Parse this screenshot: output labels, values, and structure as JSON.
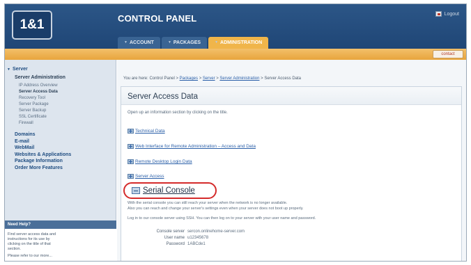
{
  "header": {
    "logo": "1&1",
    "title": "CONTROL PANEL",
    "logout_label": "Logout",
    "tabs": [
      {
        "label": "ACCOUNT"
      },
      {
        "label": "PACKAGES"
      },
      {
        "label": "ADMINISTRATION"
      }
    ],
    "strip_button": "contact"
  },
  "sidebar": {
    "section": "Server",
    "subsection": "Server Administration",
    "items": [
      {
        "label": "IP Address Overview"
      },
      {
        "label": "Server Access Data"
      },
      {
        "label": "Recovery Tool"
      },
      {
        "label": "Server Package"
      },
      {
        "label": "Server Backup"
      },
      {
        "label": "SSL Certificate"
      },
      {
        "label": "Firewall"
      }
    ],
    "main_items": [
      {
        "label": "Domains"
      },
      {
        "label": "E-mail"
      },
      {
        "label": "WebMail"
      },
      {
        "label": "Websites & Applications"
      },
      {
        "label": "Package Information"
      },
      {
        "label": "Order More Features"
      }
    ],
    "help": {
      "title": "Need Help?",
      "text": "Find server access data and instructions for its use by clicking on the title of that section.",
      "more": "Please refer to our more..."
    }
  },
  "main": {
    "breadcrumb": {
      "prefix": "You are here: Control Panel >",
      "links": [
        "Packages",
        "Server",
        "Server Administration"
      ],
      "current": "Server Access Data",
      "sep": ">"
    },
    "panel_title": "Server Access Data",
    "intro": "Open up an information section by clicking on the title.",
    "sections": [
      {
        "label": "Technical Data"
      },
      {
        "label": "Web Interface for Remote Administration – Access and Data"
      },
      {
        "label": "Remote Desktop Login Data"
      },
      {
        "label": "Server Access"
      }
    ],
    "serial": {
      "label": "Serial Console",
      "desc1": "With the serial console you can still reach your server when the network is no longer available.",
      "desc2": "Also you can reach and change your server's settings even when your server does not boot up properly.",
      "login": "Log in to our console server using SSH. You can then log on to your server with your user name and password.",
      "fields": [
        {
          "key": "Console server",
          "value": "sercon.onlinehome-server.com"
        },
        {
          "key": "User name",
          "value": "u12345678"
        },
        {
          "key": "Password",
          "value": "1ABCde1"
        }
      ]
    }
  }
}
